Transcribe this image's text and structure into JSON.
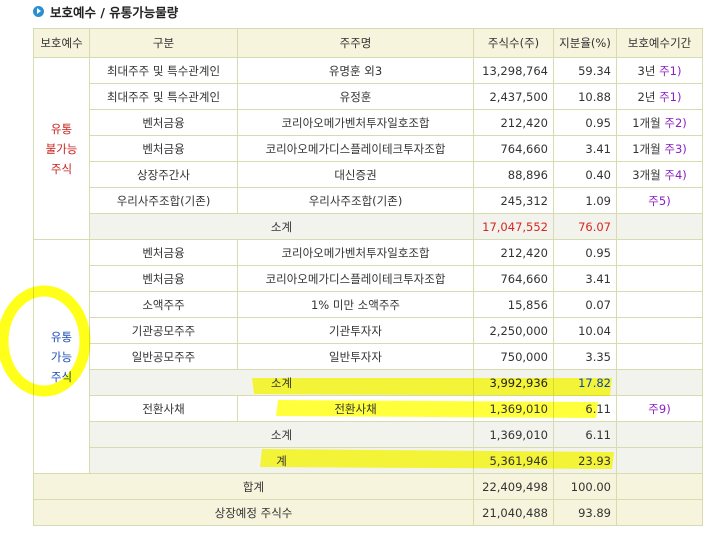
{
  "heading": "보호예수 / 유통가능물량",
  "headers": [
    "보호예수",
    "구분",
    "주주명",
    "주식수(주)",
    "지분율(%)",
    "보호예수기간"
  ],
  "locked": {
    "group_label": [
      "유통",
      "불가능",
      "주식"
    ],
    "rows": [
      {
        "category": "최대주주 및 특수관계인",
        "holder": "유명훈 외3",
        "shares": "13,298,764",
        "pct": "59.34",
        "period": "3년",
        "note": "주1)"
      },
      {
        "category": "최대주주 및 특수관계인",
        "holder": "유정훈",
        "shares": "2,437,500",
        "pct": "10.88",
        "period": "2년",
        "note": "주1)"
      },
      {
        "category": "벤처금융",
        "holder": "코리아오메가벤처투자일호조합",
        "shares": "212,420",
        "pct": "0.95",
        "period": "1개월",
        "note": "주2)"
      },
      {
        "category": "벤처금융",
        "holder": "코리아오메가디스플레이테크투자조합",
        "shares": "764,660",
        "pct": "3.41",
        "period": "1개월",
        "note": "주3)"
      },
      {
        "category": "상장주간사",
        "holder": "대신증권",
        "shares": "88,896",
        "pct": "0.40",
        "period": "3개월",
        "note": "주4)"
      },
      {
        "category": "우리사주조합(기존)",
        "holder": "우리사주조합(기존)",
        "shares": "245,312",
        "pct": "1.09",
        "period": "",
        "note": "주5)"
      }
    ],
    "subtotal": {
      "label": "소계",
      "shares": "17,047,552",
      "pct": "76.07"
    }
  },
  "free": {
    "group_label": [
      "유통",
      "가능",
      "주식"
    ],
    "rows": [
      {
        "category": "벤처금융",
        "holder": "코리아오메가벤처투자일호조합",
        "shares": "212,420",
        "pct": "0.95"
      },
      {
        "category": "벤처금융",
        "holder": "코리아오메가디스플레이테크투자조합",
        "shares": "764,660",
        "pct": "3.41"
      },
      {
        "category": "소액주주",
        "holder": "1% 미만 소액주주",
        "shares": "15,856",
        "pct": "0.07"
      },
      {
        "category": "기관공모주주",
        "holder": "기관투자자",
        "shares": "2,250,000",
        "pct": "10.04"
      },
      {
        "category": "일반공모주주",
        "holder": "일반투자자",
        "shares": "750,000",
        "pct": "3.35"
      }
    ],
    "subtotal": {
      "label": "소계",
      "shares": "3,992,936",
      "pct": "17.82"
    },
    "cb_row": {
      "category": "전환사채",
      "holder": "전환사채",
      "shares": "1,369,010",
      "pct": "6.11",
      "note": "주9)"
    },
    "cb_subtotal": {
      "label": "소계",
      "shares": "1,369,010",
      "pct": "6.11"
    },
    "total": {
      "label": "계",
      "shares": "5,361,946",
      "pct": "23.93"
    }
  },
  "grand_total": {
    "label": "합계",
    "shares": "22,409,498",
    "pct": "100.00"
  },
  "listed_total": {
    "label": "상장예정 주식수",
    "shares": "21,040,488",
    "pct": "93.89"
  },
  "colors": {
    "highlight": "#ffff1a",
    "red": "#d8261f",
    "blue": "#0b41b7",
    "note": "#8b1fc6",
    "header_bg": "#f6f4dc",
    "border": "#d6dcb0"
  }
}
